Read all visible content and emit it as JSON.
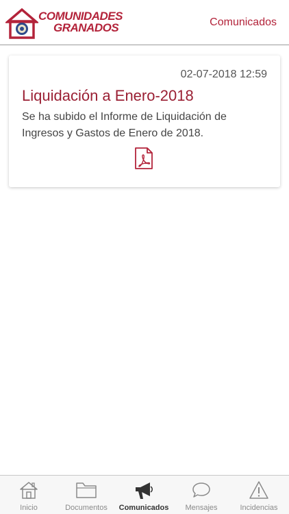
{
  "header": {
    "logo_line1": "COMUNIDADES",
    "logo_line2": "GRANADOS",
    "title": "Comunicados"
  },
  "announcements": [
    {
      "date": "02-07-2018 12:59",
      "title": "Liquidación a Enero-2018",
      "body": "Se ha subido el Informe de Liquidación de Ingresos y Gastos de Enero de 2018.",
      "attachment_icon": "pdf-icon"
    }
  ],
  "tabbar": {
    "tabs": [
      {
        "label": "Inicio",
        "icon": "home-icon",
        "active": false
      },
      {
        "label": "Documentos",
        "icon": "folder-icon",
        "active": false
      },
      {
        "label": "Comunicados",
        "icon": "megaphone-icon",
        "active": true
      },
      {
        "label": "Mensajes",
        "icon": "chat-bubble-icon",
        "active": false
      },
      {
        "label": "Incidencias",
        "icon": "warning-icon",
        "active": false
      }
    ]
  },
  "colors": {
    "brand": "#b3233a",
    "title": "#9a1f33",
    "tab_inactive": "#8a8a8a",
    "tab_active": "#333333"
  }
}
